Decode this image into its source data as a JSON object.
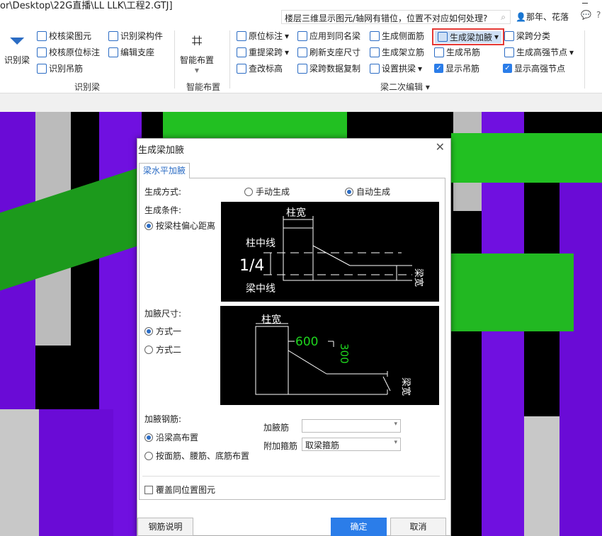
{
  "title": "or\\Desktop\\22G直播\\LL LLK\\工程2.GTJ]",
  "help_search": "楼层三维显示图元/轴网有错位，位置不对应如何处理?",
  "user": "那年、花落",
  "ribbon": {
    "g1": {
      "big": "识别梁",
      "items": [
        "校核梁图元",
        "校核原位标注",
        "识别吊筋",
        "识别梁构件",
        "编辑支座"
      ],
      "label": "识别梁"
    },
    "g2": {
      "big": "智能布置",
      "label": "智能布置"
    },
    "g3": {
      "items": [
        "原位标注",
        "重提梁跨",
        "查改标高",
        "应用到同名梁",
        "刷新支座尺寸",
        "梁跨数据复制",
        "生成侧面筋",
        "生成架立筋",
        "设置拱梁",
        "生成梁加腋",
        "生成吊筋",
        "显示吊筋",
        "梁跨分类",
        "生成高强节点",
        "显示高强节点"
      ],
      "label": "梁二次编辑"
    },
    "highlight_color": "#e53935"
  },
  "dialog": {
    "title": "生成梁加腋",
    "tab": "梁水平加腋",
    "method_label": "生成方式:",
    "manual": "手动生成",
    "auto": "自动生成",
    "cond_label": "生成条件:",
    "cond_opt": "按梁柱偏心距离",
    "size_label": "加腋尺寸:",
    "size_opt1": "方式一",
    "size_opt2": "方式二",
    "rebar_label": "加腋钢筋:",
    "rebar_opt1": "沿梁高布置",
    "rebar_opt2": "按面筋、腰筋、底筋布置",
    "jiaye_jin": "加腋筋",
    "jiaye_jin_value": "",
    "fujia_gujin": "附加箍筋",
    "fujia_gujin_value": "取梁箍筋",
    "overwrite": "覆盖同位置图元",
    "btn_help": "钢筋说明",
    "btn_ok": "确定",
    "btn_cancel": "取消",
    "diag1": {
      "col_width": "柱宽",
      "col_center": "柱中线",
      "ratio": "1/4",
      "beam_center": "梁中线",
      "beam_width": "梁宽"
    },
    "diag2": {
      "col_width": "柱宽",
      "len": "600",
      "height": "300",
      "beam_width": "梁宽"
    }
  }
}
